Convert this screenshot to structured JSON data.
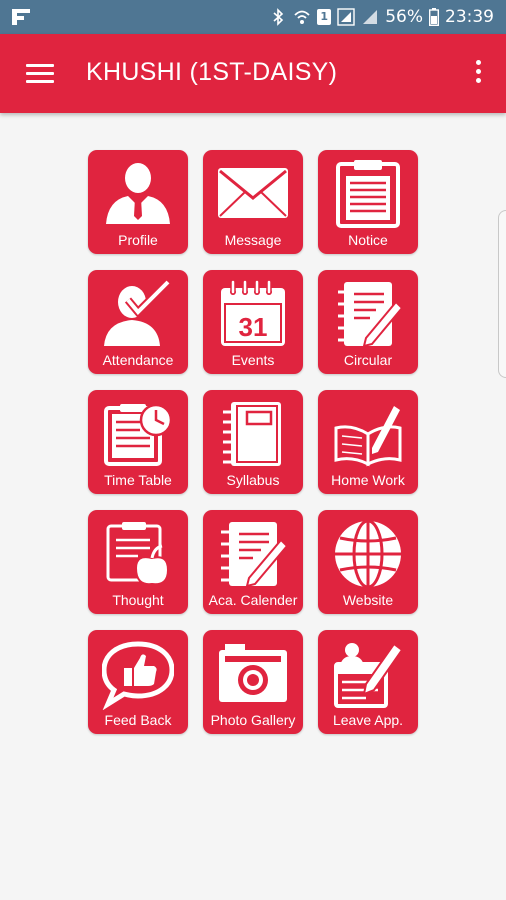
{
  "status_bar": {
    "battery": "56%",
    "time": "23:39",
    "sim_badge": "1"
  },
  "app_bar": {
    "title": "KHUSHI (1ST-DAISY)"
  },
  "tiles": [
    {
      "label": "Profile",
      "icon": "profile-icon"
    },
    {
      "label": "Message",
      "icon": "message-icon"
    },
    {
      "label": "Notice",
      "icon": "notice-icon"
    },
    {
      "label": "Attendance",
      "icon": "attendance-icon"
    },
    {
      "label": "Events",
      "icon": "events-icon",
      "day": "31"
    },
    {
      "label": "Circular",
      "icon": "circular-icon"
    },
    {
      "label": "Time Table",
      "icon": "time-table-icon"
    },
    {
      "label": "Syllabus",
      "icon": "syllabus-icon"
    },
    {
      "label": "Home Work",
      "icon": "home-work-icon"
    },
    {
      "label": "Thought",
      "icon": "thought-icon"
    },
    {
      "label": "Aca. Calender",
      "icon": "aca-calender-icon"
    },
    {
      "label": "Website",
      "icon": "website-icon"
    },
    {
      "label": "Feed Back",
      "icon": "feed-back-icon"
    },
    {
      "label": "Photo Gallery",
      "icon": "photo-gallery-icon"
    },
    {
      "label": "Leave App.",
      "icon": "leave-app-icon"
    }
  ],
  "colors": {
    "accent": "#e0243f",
    "status_bar": "#4f7693",
    "background": "#f5f5f5"
  }
}
